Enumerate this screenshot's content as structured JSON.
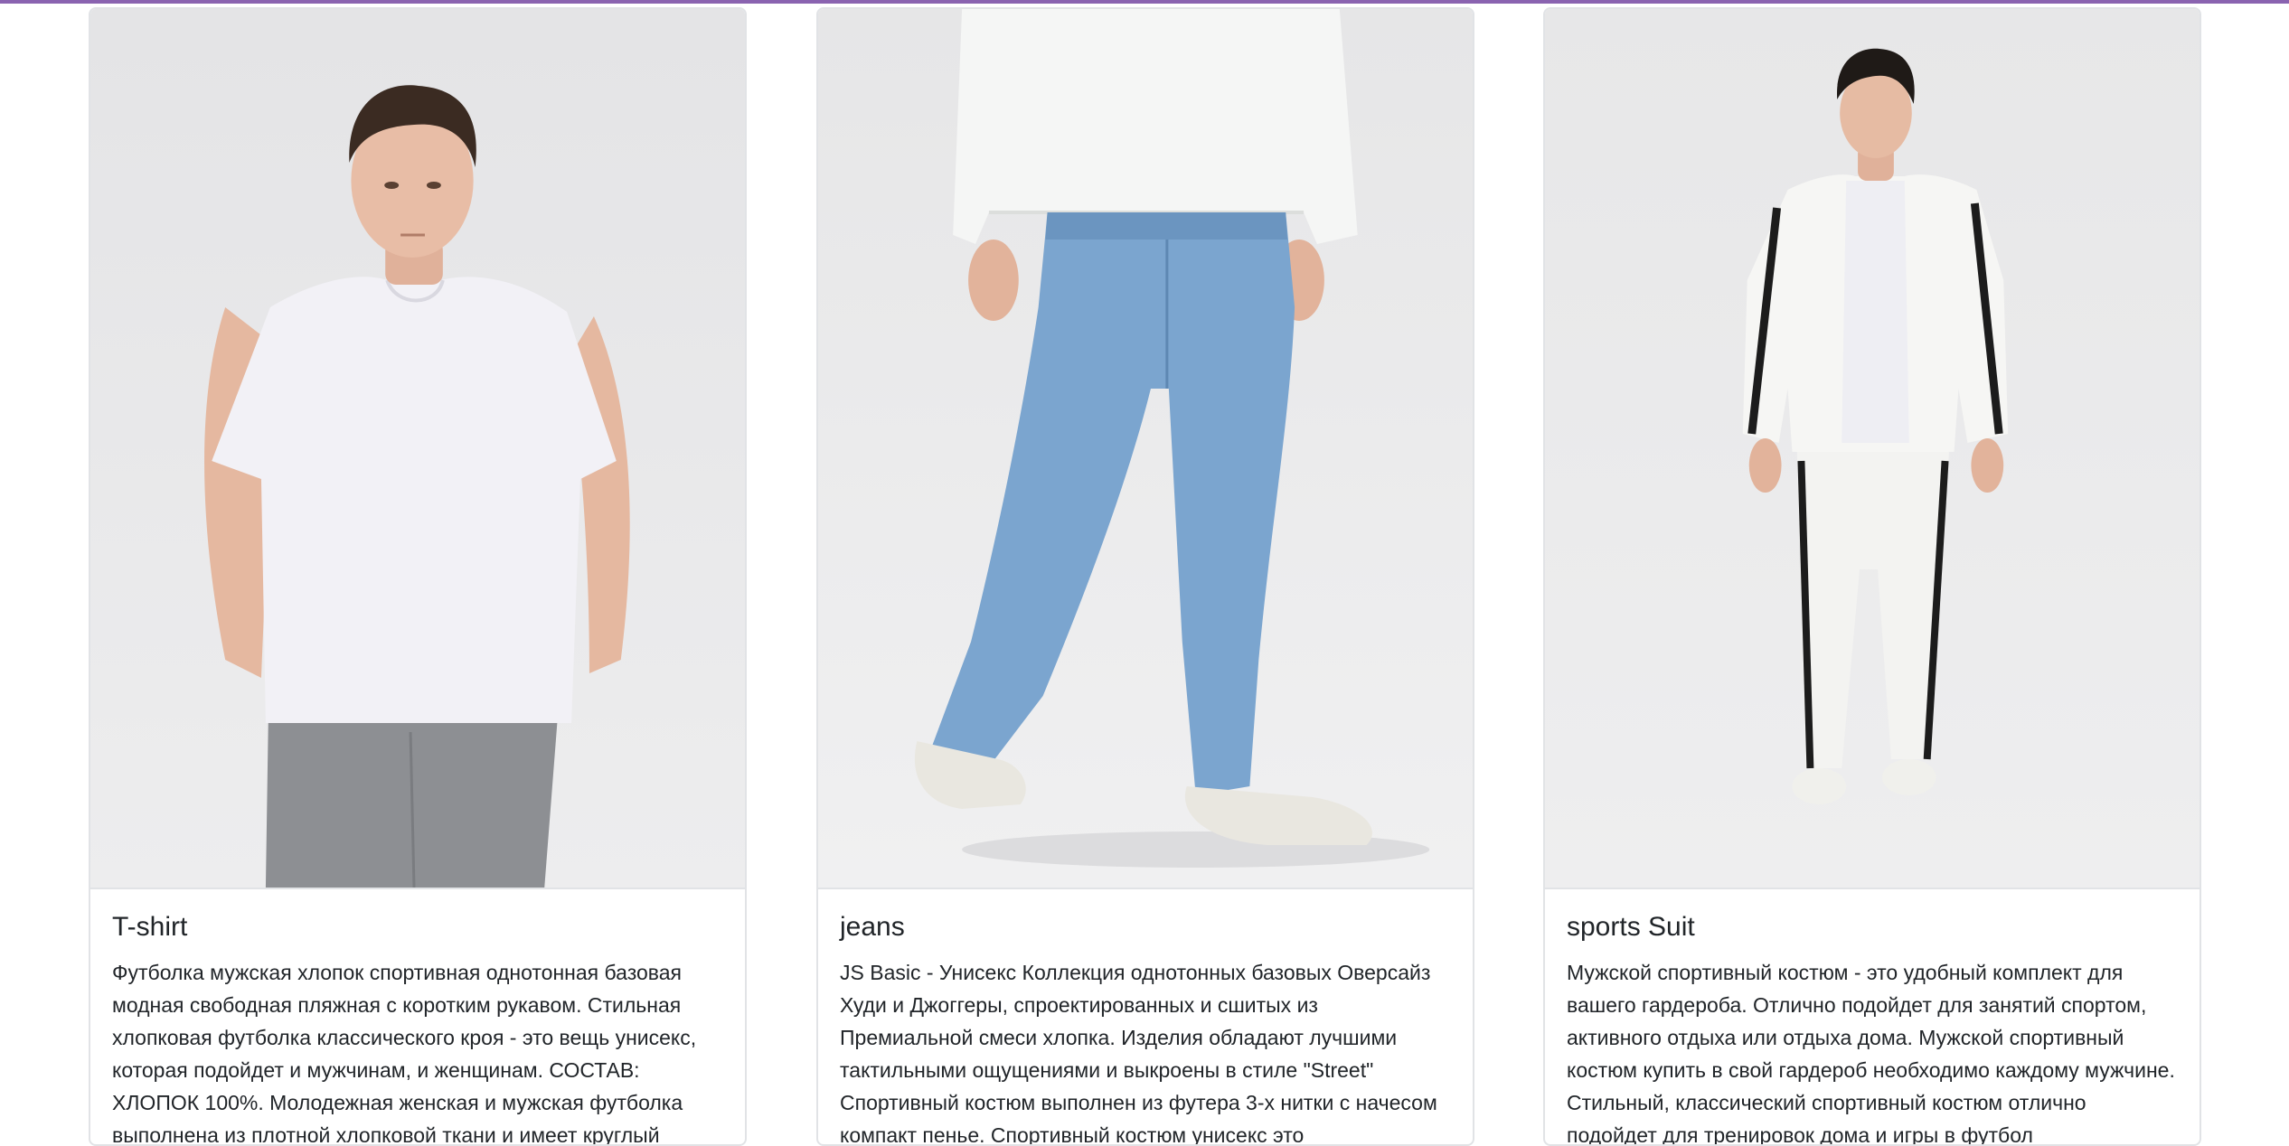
{
  "colors": {
    "accent": "#8a63b0",
    "card_border": "#e1e3e6",
    "text": "#212529"
  },
  "products": [
    {
      "title": "T-shirt",
      "image_alt": "man in white t-shirt and grey jeans",
      "description": "Футболка мужская хлопок спортивная однотонная базовая модная свободная пляжная с коротким рукавом. Стильная хлопковая футболка классического кроя - это вещь унисекс, которая подойдет и мужчинам, и женщинам. СОСТАВ: ХЛОПОК 100%. Молодежная женская и мужская футболка выполнена из плотной хлопковой ткани и имеет круглый"
    },
    {
      "title": "jeans",
      "image_alt": "man in light blue jeans and white sweater",
      "description": "JS Basic - Унисекс Коллекция однотонных базовых Оверсайз Худи и Джоггеры, спроектированных и сшитых из Премиальной смеси хлопка. Изделия обладают лучшими тактильными ощущениями и выкроены в стиле \"Street\" Спортивный костюм выполнен из футера 3-х нитки с начесом компакт пенье. Спортивный костюм унисекс это"
    },
    {
      "title": "sports Suit",
      "image_alt": "man in white sports suit with black stripes",
      "description": "Мужской спортивный костюм - это удобный комплект для вашего гардероба. Отлично подойдет для занятий спортом, активного отдыха или отдыха дома. Мужской спортивный костюм купить в свой гардероб необходимо каждому мужчине. Стильный, классический спортивный костюм отлично подойдет для тренировок дома и игры в футбол"
    }
  ]
}
